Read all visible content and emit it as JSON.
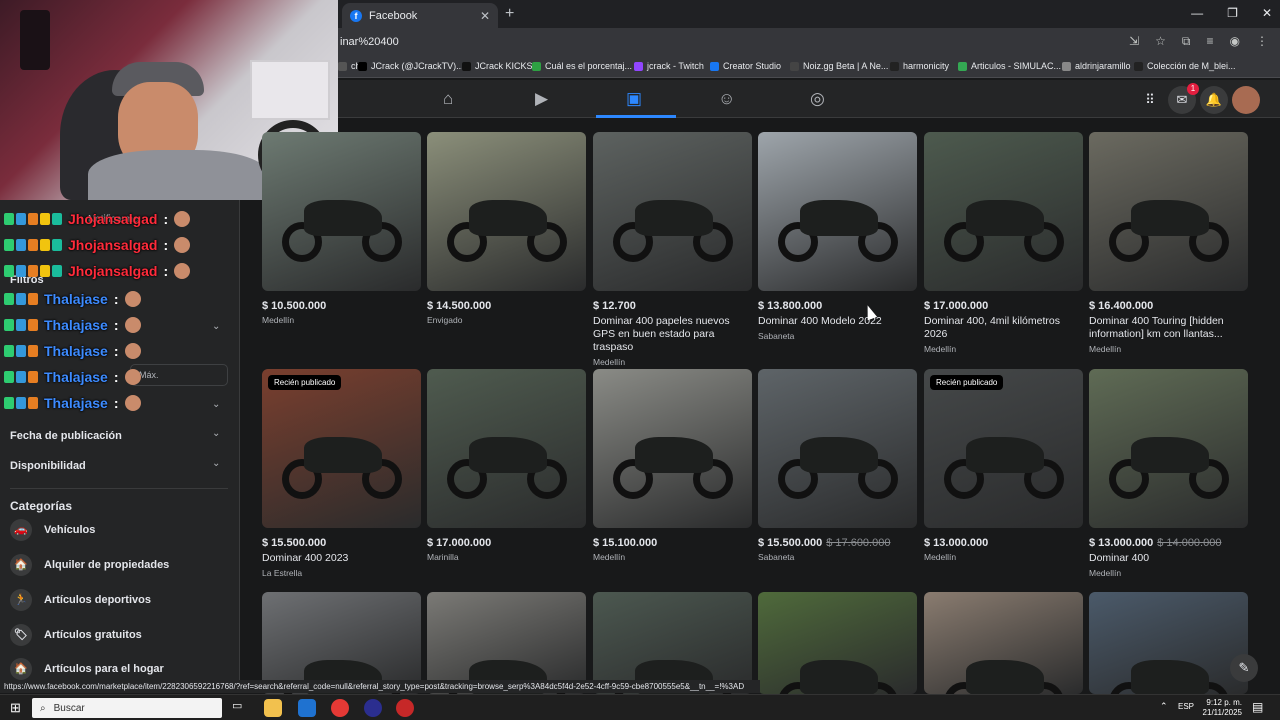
{
  "browser": {
    "tab_title": "Facebook",
    "url": "inar%20400",
    "bookmarks": [
      {
        "label": "ch",
        "color": "#555"
      },
      {
        "label": "JCrack (@JCrackTV)...",
        "color": "#000"
      },
      {
        "label": "JCrack KICKS",
        "color": "#111"
      },
      {
        "label": "Cuál es el porcentaj...",
        "color": "#2ea043"
      },
      {
        "label": "jcrack - Twitch",
        "color": "#9146ff"
      },
      {
        "label": "Creator Studio",
        "color": "#1877f2"
      },
      {
        "label": "Noiz.gg Beta | A Ne...",
        "color": "#444"
      },
      {
        "label": "harmonicity",
        "color": "#222"
      },
      {
        "label": "Articulos - SIMULAC...",
        "color": "#34a853"
      },
      {
        "label": "aldrinjaramillo",
        "color": "#888"
      },
      {
        "label": "Colección de M_blei...",
        "color": "#222"
      }
    ]
  },
  "header": {
    "nav": [
      "home",
      "watch",
      "marketplace",
      "groups",
      "gaming"
    ],
    "messenger_badge": "1"
  },
  "sidebar": {
    "filters_label": "Filtros",
    "notify_label": "Notificarme",
    "max_placeholder": "Máx.",
    "sections": [
      "Fecha de publicación",
      "Disponibilidad"
    ],
    "categories_heading": "Categorías",
    "categories": [
      {
        "label": "Vehículos",
        "icon": "🚗"
      },
      {
        "label": "Alquiler de propiedades",
        "icon": "🏠"
      },
      {
        "label": "Artículos deportivos",
        "icon": "🏃"
      },
      {
        "label": "Artículos gratuitos",
        "icon": "🏷"
      },
      {
        "label": "Artículos para el hogar",
        "icon": "🏠"
      }
    ]
  },
  "chat": [
    {
      "name": "Jhojansalgad",
      "color": "#ff2b3b"
    },
    {
      "name": "Jhojansalgad",
      "color": "#ff2b3b"
    },
    {
      "name": "Jhojansalgad",
      "color": "#ff2b3b"
    },
    {
      "name": "Thalajase",
      "color": "#3d8bff"
    },
    {
      "name": "Thalajase",
      "color": "#3d8bff"
    },
    {
      "name": "Thalajase",
      "color": "#3d8bff"
    },
    {
      "name": "Thalajase",
      "color": "#3d8bff"
    },
    {
      "name": "Thalajase",
      "color": "#3d8bff"
    }
  ],
  "listings": [
    {
      "price": "$ 10.500.000",
      "old_price": "",
      "title": "",
      "location": "Medellín",
      "tag": "",
      "bg": "#6d7a72"
    },
    {
      "price": "$ 14.500.000",
      "old_price": "",
      "title": "",
      "location": "Envigado",
      "tag": "",
      "bg": "#8b8f7a"
    },
    {
      "price": "$ 12.700",
      "old_price": "",
      "title": "Dominar 400 papeles nuevos GPS en buen estado para traspaso",
      "location": "Medellín",
      "tag": "",
      "bg": "#5d6260"
    },
    {
      "price": "$ 13.800.000",
      "old_price": "",
      "title": "Dominar 400 Modelo 2022",
      "location": "Sabaneta",
      "tag": "",
      "bg": "#9ea5ab"
    },
    {
      "price": "$ 17.000.000",
      "old_price": "",
      "title": "Dominar 400, 4mil kilómetros 2026",
      "location": "Medellín",
      "tag": "",
      "bg": "#4d5a4e"
    },
    {
      "price": "$ 16.400.000",
      "old_price": "",
      "title": "Dominar 400 Touring [hidden information] km con llantas...",
      "location": "Medellín",
      "tag": "",
      "bg": "#6b6a60"
    },
    {
      "price": "$ 15.500.000",
      "old_price": "",
      "title": "Dominar 400 2023",
      "location": "La Estrella",
      "tag": "Recién publicado",
      "bg": "#7a3f2e"
    },
    {
      "price": "$ 17.000.000",
      "old_price": "",
      "title": "",
      "location": "Marinilla",
      "tag": "",
      "bg": "#4f5b4f"
    },
    {
      "price": "$ 15.100.000",
      "old_price": "",
      "title": "",
      "location": "Medellín",
      "tag": "",
      "bg": "#8a8b86"
    },
    {
      "price": "$ 15.500.000",
      "old_price": "$ 17.600.000",
      "title": "",
      "location": "Sabaneta",
      "tag": "",
      "bg": "#5e6468"
    },
    {
      "price": "$ 13.000.000",
      "old_price": "",
      "title": "",
      "location": "Medellín",
      "tag": "Recién publicado",
      "bg": "#454849"
    },
    {
      "price": "$ 13.000.000",
      "old_price": "$ 14.000.000",
      "title": "Dominar 400",
      "location": "Medellín",
      "tag": "",
      "bg": "#5f6b55"
    },
    {
      "price": "",
      "old_price": "",
      "title": "",
      "location": "",
      "tag": "",
      "bg": "#6e7073"
    },
    {
      "price": "",
      "old_price": "",
      "title": "",
      "location": "",
      "tag": "",
      "bg": "#7b7a76"
    },
    {
      "price": "",
      "old_price": "",
      "title": "",
      "location": "",
      "tag": "",
      "bg": "#4c5850"
    },
    {
      "price": "",
      "old_price": "",
      "title": "",
      "location": "",
      "tag": "",
      "bg": "#4f6a3b"
    },
    {
      "price": "",
      "old_price": "",
      "title": "",
      "location": "",
      "tag": "",
      "bg": "#8a7c70"
    },
    {
      "price": "",
      "old_price": "",
      "title": "",
      "location": "",
      "tag": "",
      "bg": "#4b5a6a"
    }
  ],
  "status_url": "https://www.facebook.com/marketplace/item/2282306592216768/?ref=search&referral_code=null&referral_story_type=post&tracking=browse_serp%3A84dc5f4d-2e52-4cff-9c59-cbe8700555e5&__tn__=!%3AD",
  "taskbar": {
    "search_label": "Buscar",
    "lang": "ESP",
    "time": "9:12 p. m.",
    "date": "21/11/2025"
  }
}
